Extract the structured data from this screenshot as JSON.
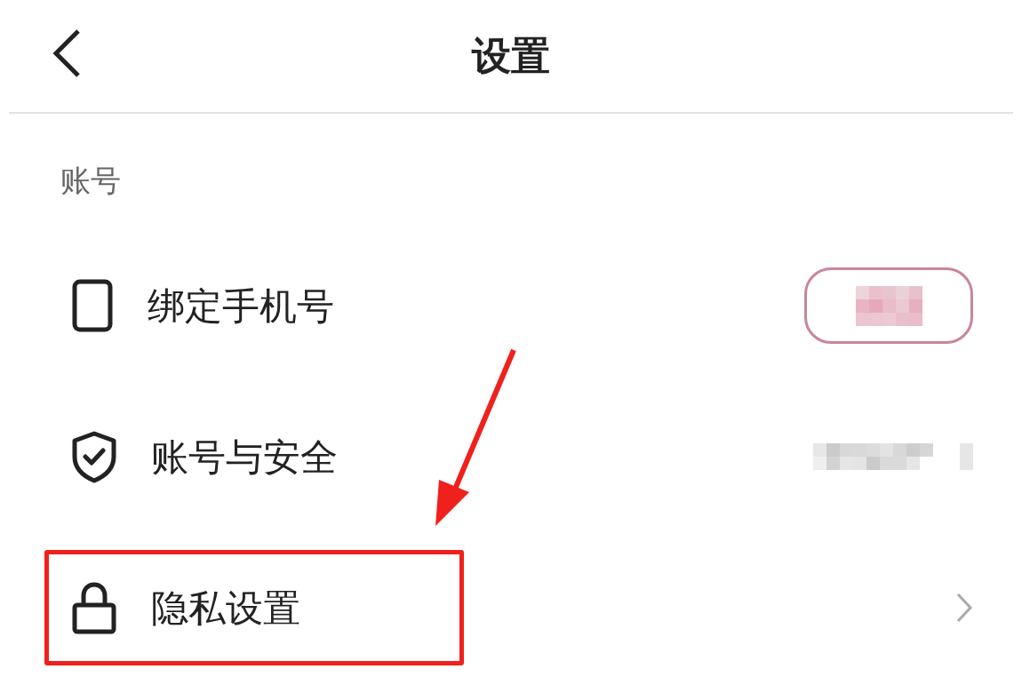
{
  "header": {
    "title": "设置"
  },
  "section": {
    "label": "账号"
  },
  "rows": [
    {
      "label": "绑定手机号",
      "kind": "redacted-badge",
      "highlighted": false
    },
    {
      "label": "账号与安全",
      "kind": "redacted-text",
      "highlighted": false
    },
    {
      "label": "隐私设置",
      "kind": "chevron",
      "highlighted": true
    }
  ]
}
